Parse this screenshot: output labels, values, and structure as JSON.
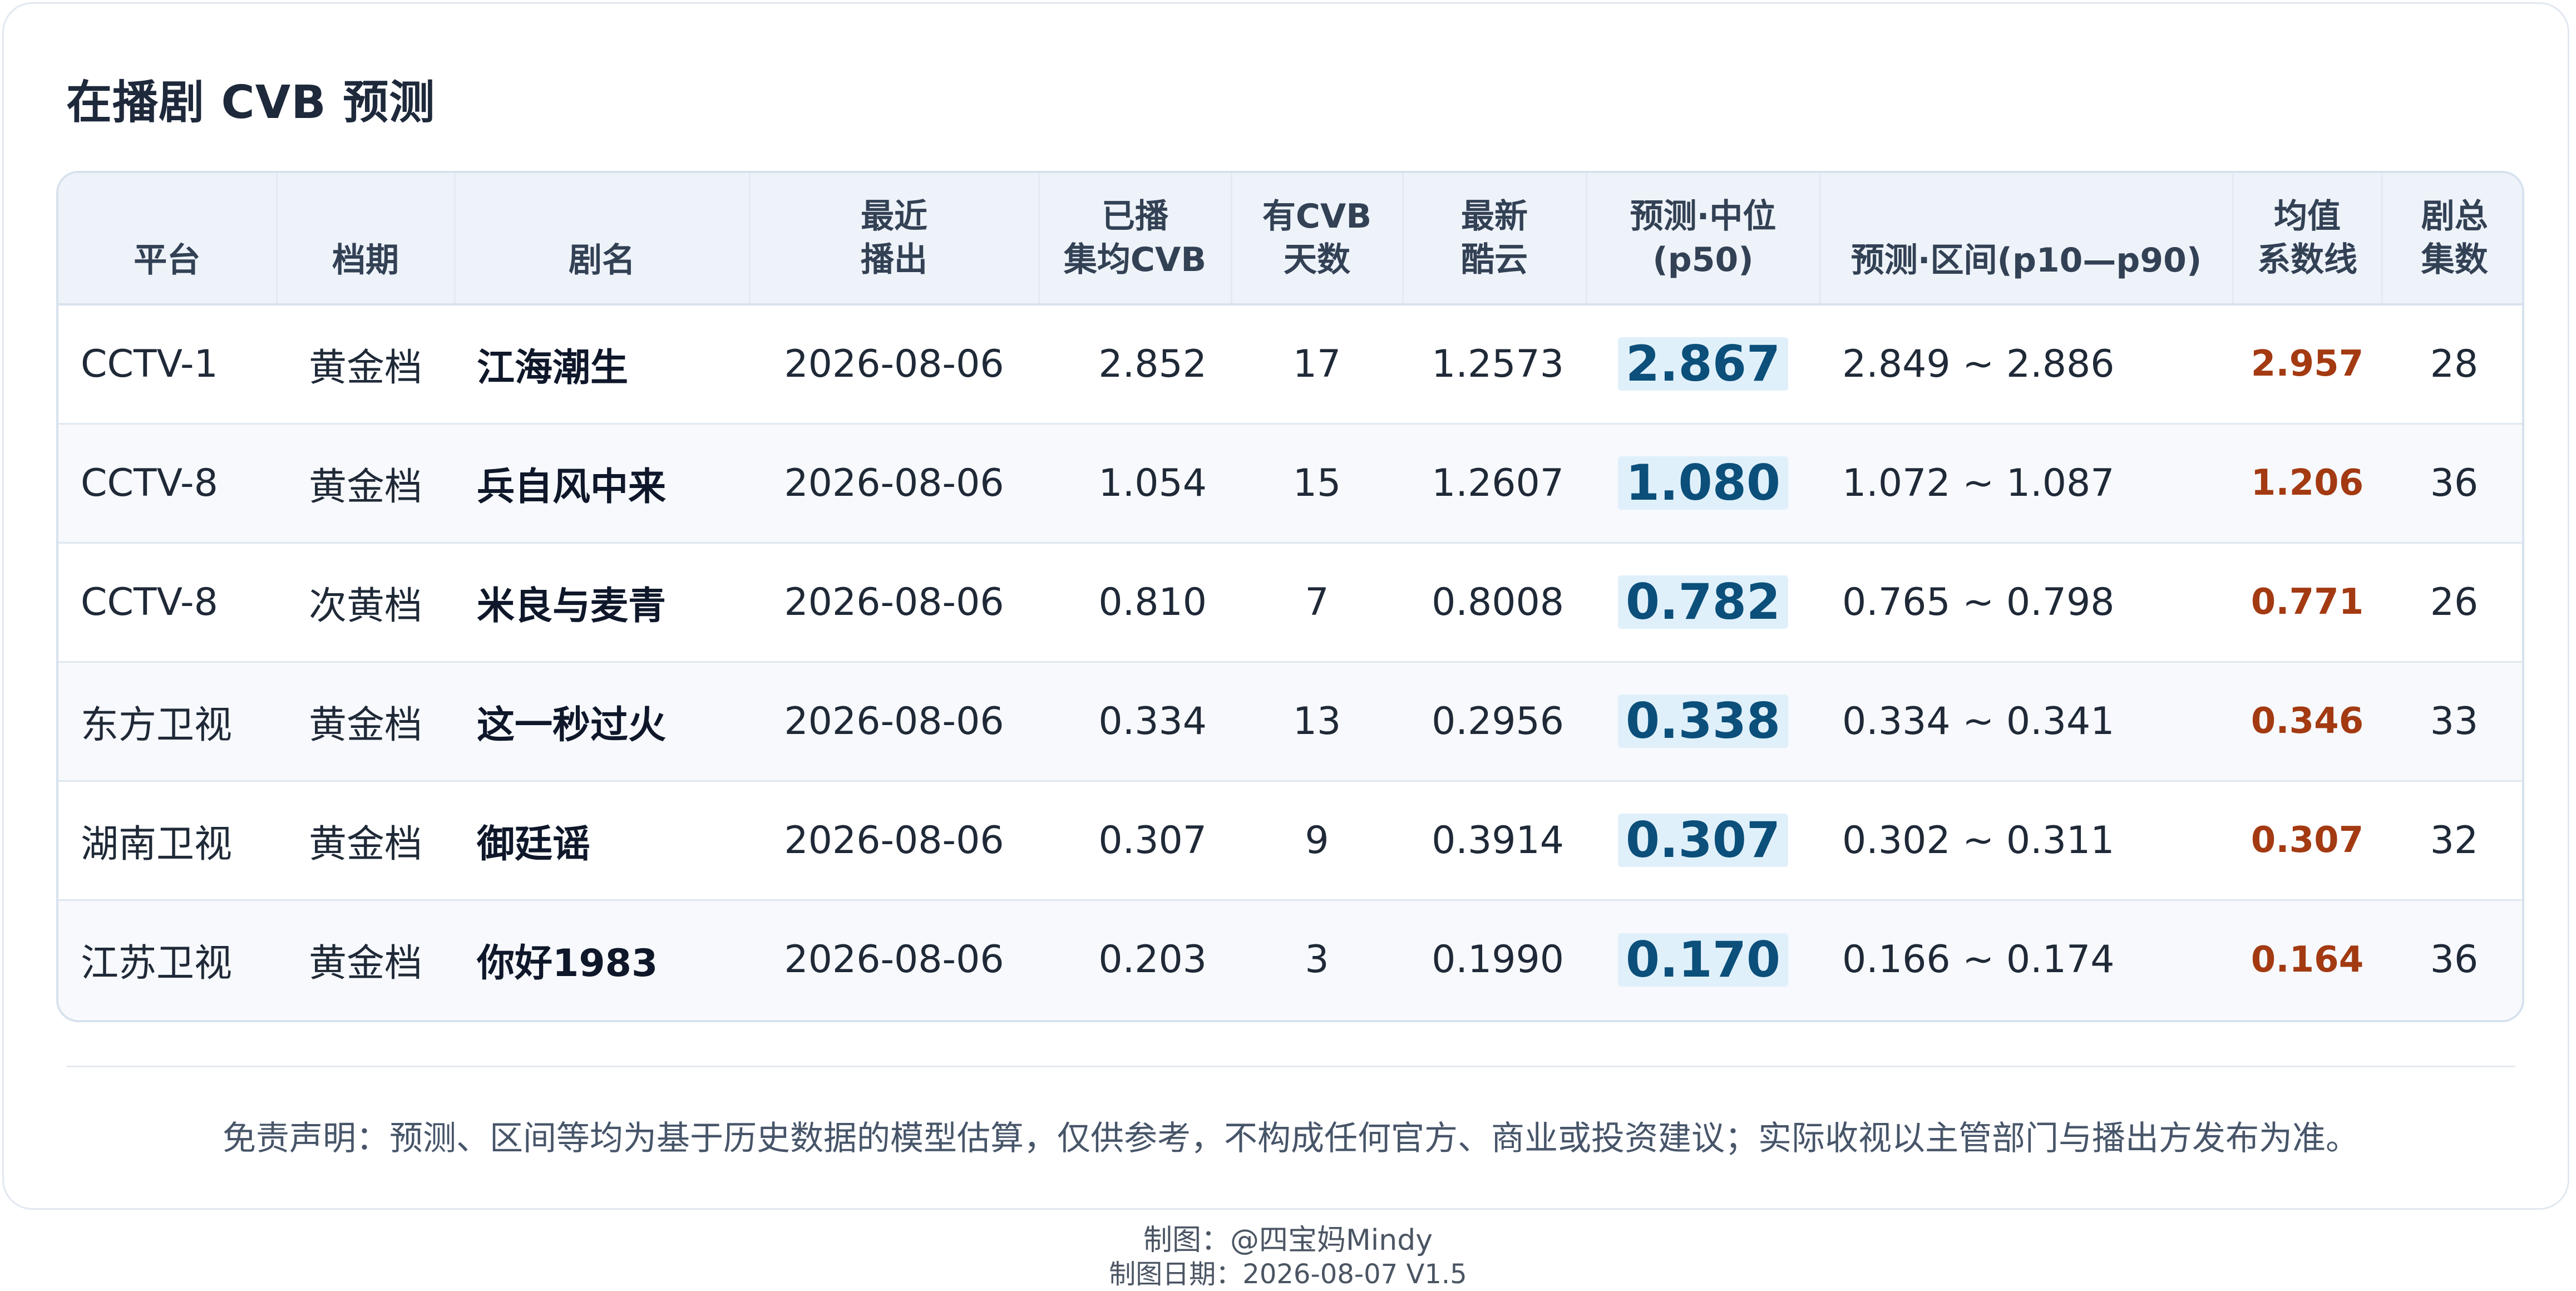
{
  "title": "在播剧 CVB 预测",
  "headers": {
    "platform": "平台",
    "slot": "档期",
    "name": "剧名",
    "recent": "最近\n播出",
    "aired_cvb": "已播\n集均CVB",
    "cvb_days": "有CVB\n天数",
    "latest_kuyun": "最新\n酷云",
    "p50": "预测·中位\n(p50)",
    "range": "预测·区间(p10—p90)",
    "mean_line": "均值\n系数线",
    "total_eps": "剧总\n集数"
  },
  "rows": [
    {
      "platform": "CCTV-1",
      "slot": "黄金档",
      "name": "江海潮生",
      "date": "2026-08-06",
      "aired_cvb": "2.852",
      "cvb_days": "17",
      "kuyun": "1.2573",
      "p50": "2.867",
      "range": "2.849 ~ 2.886",
      "mean": "2.957",
      "episodes": "28"
    },
    {
      "platform": "CCTV-8",
      "slot": "黄金档",
      "name": "兵自风中来",
      "date": "2026-08-06",
      "aired_cvb": "1.054",
      "cvb_days": "15",
      "kuyun": "1.2607",
      "p50": "1.080",
      "range": "1.072 ~ 1.087",
      "mean": "1.206",
      "episodes": "36"
    },
    {
      "platform": "CCTV-8",
      "slot": "次黄档",
      "name": "米良与麦青",
      "date": "2026-08-06",
      "aired_cvb": "0.810",
      "cvb_days": "7",
      "kuyun": "0.8008",
      "p50": "0.782",
      "range": "0.765 ~ 0.798",
      "mean": "0.771",
      "episodes": "26"
    },
    {
      "platform": "东方卫视",
      "slot": "黄金档",
      "name": "这一秒过火",
      "date": "2026-08-06",
      "aired_cvb": "0.334",
      "cvb_days": "13",
      "kuyun": "0.2956",
      "p50": "0.338",
      "range": "0.334 ~ 0.341",
      "mean": "0.346",
      "episodes": "33"
    },
    {
      "platform": "湖南卫视",
      "slot": "黄金档",
      "name": "御廷谣",
      "date": "2026-08-06",
      "aired_cvb": "0.307",
      "cvb_days": "9",
      "kuyun": "0.3914",
      "p50": "0.307",
      "range": "0.302 ~ 0.311",
      "mean": "0.307",
      "episodes": "32"
    },
    {
      "platform": "江苏卫视",
      "slot": "黄金档",
      "name": "你好1983",
      "date": "2026-08-06",
      "aired_cvb": "0.203",
      "cvb_days": "3",
      "kuyun": "0.1990",
      "p50": "0.170",
      "range": "0.166 ~ 0.174",
      "mean": "0.164",
      "episodes": "36"
    }
  ],
  "disclaimer": "免责声明：预测、区间等均为基于历史数据的模型估算，仅供参考，不构成任何官方、商业或投资建议；实际收视以主管部门与播出方发布为准。",
  "credit_author": "制图：@四宝妈Mindy",
  "credit_date": "制图日期：2026-08-07 V1.5"
}
